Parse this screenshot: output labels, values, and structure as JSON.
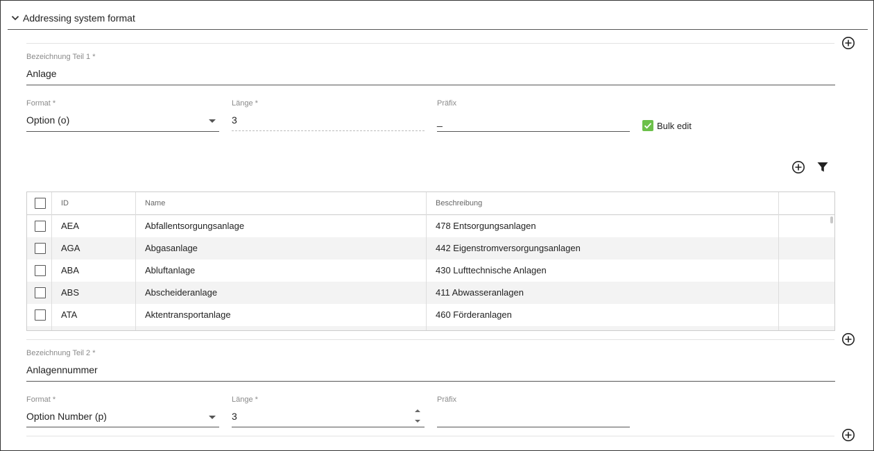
{
  "section": {
    "title": "Addressing system format"
  },
  "part1": {
    "label": "Bezeichnung Teil 1",
    "value": "Anlage",
    "format_label": "Format",
    "format_value": "Option (o)",
    "length_label": "Länge",
    "length_value": "3",
    "prefix_label": "Präfix",
    "prefix_value": "_",
    "bulk_edit_label": "Bulk edit"
  },
  "table": {
    "headers": [
      "ID",
      "Name",
      "Beschreibung"
    ],
    "rows": [
      {
        "id": "AEA",
        "name": "Abfallentsorgungsanlage",
        "desc": "478 Entsorgungsanlagen"
      },
      {
        "id": "AGA",
        "name": "Abgasanlage",
        "desc": "442 Eigenstromversorgungsanlagen"
      },
      {
        "id": "ABA",
        "name": "Abluftanlage",
        "desc": "430 Lufttechnische Anlagen"
      },
      {
        "id": "ABS",
        "name": "Abscheideranlage",
        "desc": "411 Abwasseranlagen"
      },
      {
        "id": "ATA",
        "name": "Aktentransportanlage",
        "desc": "460 Förderanlagen"
      }
    ]
  },
  "part2": {
    "label": "Bezeichnung Teil 2",
    "value": "Anlagennummer",
    "format_label": "Format",
    "format_value": "Option Number (p)",
    "length_label": "Länge",
    "length_value": "3",
    "prefix_label": "Präfix",
    "prefix_value": ""
  },
  "required_mark": "*",
  "icons": {
    "section_toggle": "chevron-down-icon",
    "add": "add-circle-icon",
    "filter": "filter-icon",
    "check": "check-icon"
  },
  "colors": {
    "accent_green": "#6cc04a"
  }
}
